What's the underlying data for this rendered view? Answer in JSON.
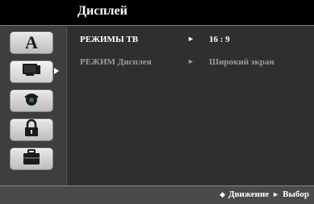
{
  "title": "Дисплей",
  "nav": {
    "items": [
      {
        "name": "language",
        "icon": "letter-a-icon"
      },
      {
        "name": "display",
        "icon": "tv-icon",
        "active": true
      },
      {
        "name": "audio",
        "icon": "audio-icon"
      },
      {
        "name": "lock",
        "icon": "lock-icon"
      },
      {
        "name": "other",
        "icon": "briefcase-icon"
      }
    ]
  },
  "menu": {
    "rows": [
      {
        "label": "РЕЖИМЫ ТВ",
        "arrow": "►",
        "value": "16 : 9"
      },
      {
        "label": "РЕЖИМ Дисплея",
        "arrow": "►",
        "value": "Широкий экран"
      }
    ]
  },
  "footer": {
    "move_glyph": "◆",
    "move_label": "Движение",
    "select_glyph": "►",
    "select_label": "Выбор"
  }
}
